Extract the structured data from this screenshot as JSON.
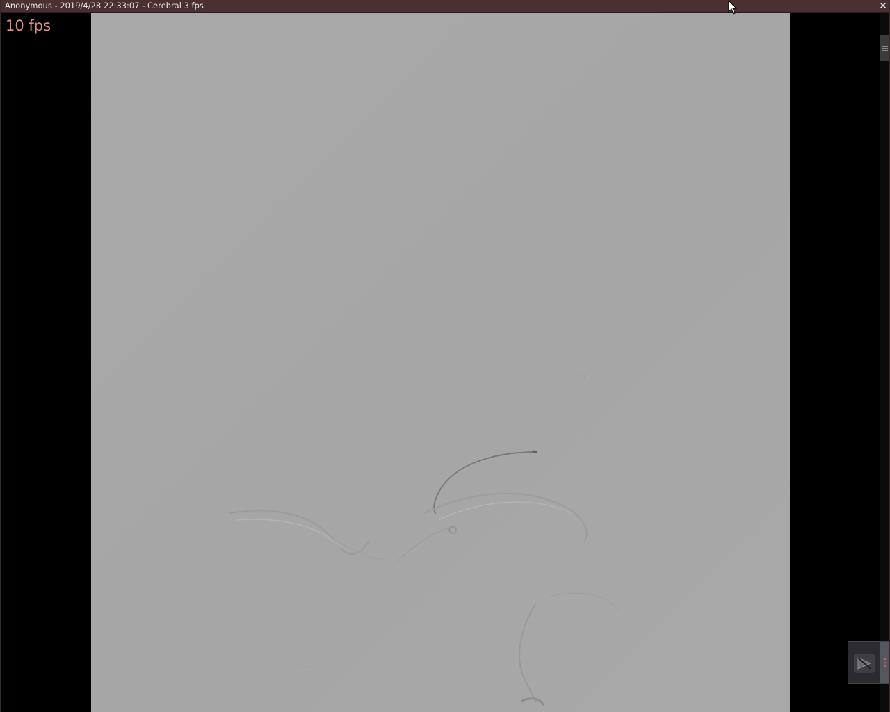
{
  "window": {
    "title": "Anonymous - 2019/4/28 22:33:07 - Cerebral 3 fps",
    "close_symbol": "✕"
  },
  "overlay": {
    "fps_label": "10 fps"
  },
  "colors": {
    "titlebar_bg": "#4a3033",
    "fps_text": "#e38b89",
    "image_bg": "#a7a7a7",
    "background": "#000000"
  },
  "icons": {
    "close": "close-icon",
    "play": "play-pause-icon",
    "menu": "vertical-dots-icon",
    "scroll_grip": "grip-icon"
  }
}
